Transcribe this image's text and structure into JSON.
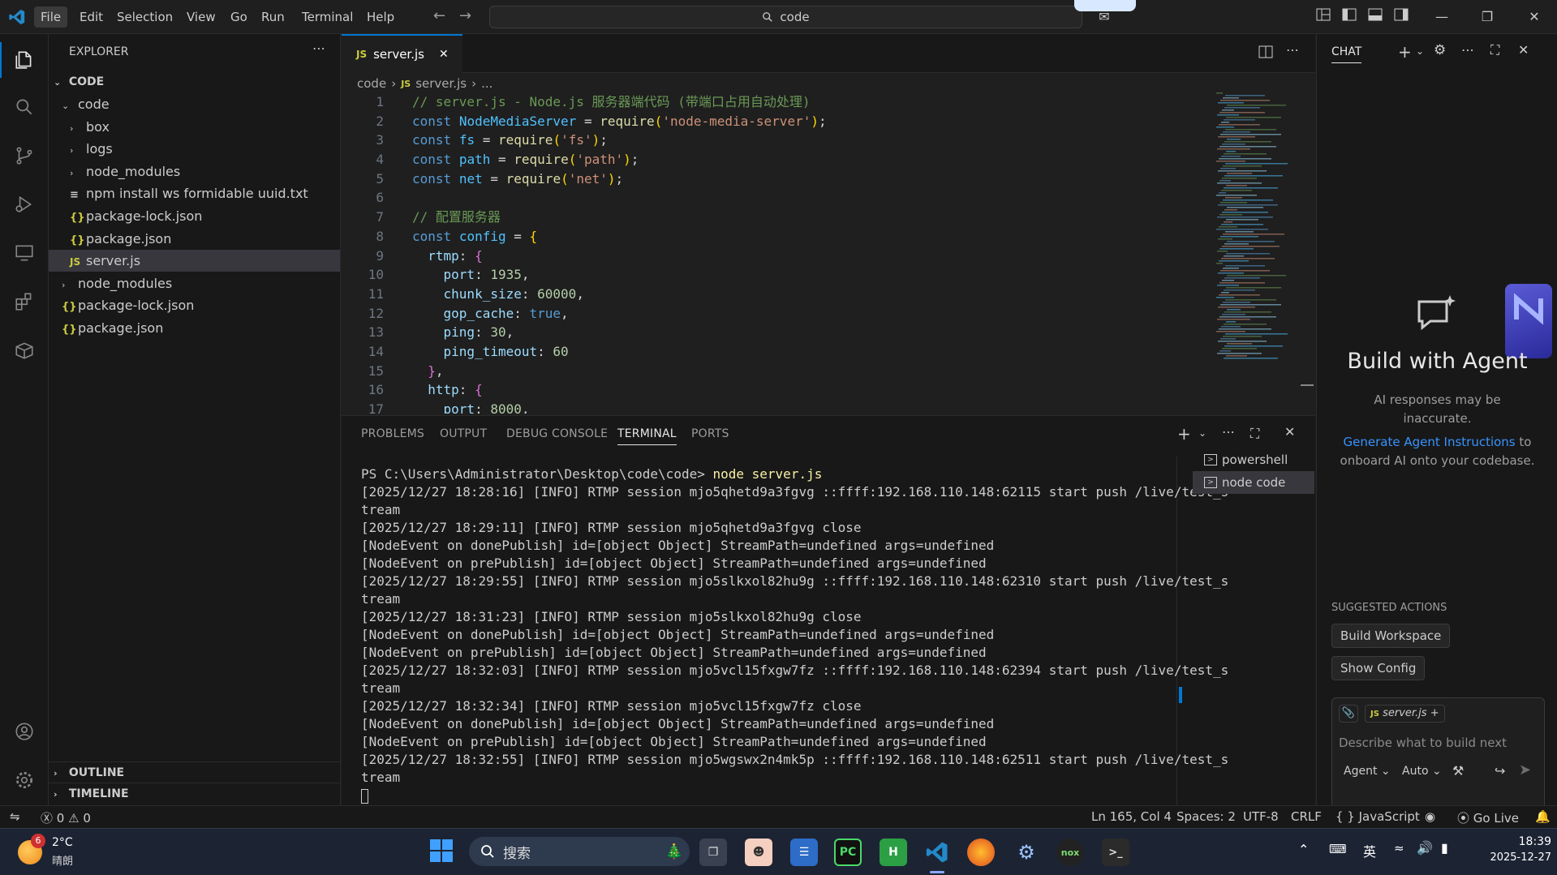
{
  "menu": [
    "File",
    "Edit",
    "Selection",
    "View",
    "Go",
    "Run",
    "Terminal",
    "Help"
  ],
  "search": {
    "text": "code"
  },
  "sidebar": {
    "title": "EXPLORER",
    "root": "CODE",
    "items": [
      {
        "label": "code",
        "kind": "folder-open",
        "depth": 1
      },
      {
        "label": "box",
        "kind": "folder",
        "depth": 2
      },
      {
        "label": "logs",
        "kind": "folder",
        "depth": 2
      },
      {
        "label": "node_modules",
        "kind": "folder",
        "depth": 2
      },
      {
        "label": "npm install ws formidable uuid.txt",
        "kind": "txt",
        "depth": 2
      },
      {
        "label": "package-lock.json",
        "kind": "json",
        "depth": 2
      },
      {
        "label": "package.json",
        "kind": "json",
        "depth": 2
      },
      {
        "label": "server.js",
        "kind": "js",
        "depth": 2,
        "selected": true
      },
      {
        "label": "node_modules",
        "kind": "folder",
        "depth": 1
      },
      {
        "label": "package-lock.json",
        "kind": "json",
        "depth": 1
      },
      {
        "label": "package.json",
        "kind": "json",
        "depth": 1
      }
    ],
    "outline": "OUTLINE",
    "timeline": "TIMELINE"
  },
  "editor": {
    "tab_label": "server.js",
    "breadcrumb": [
      "code",
      "server.js",
      "..."
    ],
    "lines": [
      "// server.js - Node.js 服务器端代码 (带端口占用自动处理)",
      "const NodeMediaServer = require('node-media-server');",
      "const fs = require('fs');",
      "const path = require('path');",
      "const net = require('net');",
      "",
      "// 配置服务器",
      "const config = {",
      "  rtmp: {",
      "    port: 1935,",
      "    chunk_size: 60000,",
      "    gop_cache: true,",
      "    ping: 30,",
      "    ping_timeout: 60",
      "  },",
      "  http: {",
      "    port: 8000,"
    ]
  },
  "panel": {
    "tabs": [
      "PROBLEMS",
      "OUTPUT",
      "DEBUG CONSOLE",
      "TERMINAL",
      "PORTS"
    ],
    "active_tab": "TERMINAL",
    "terminals": [
      "powershell",
      "node  code"
    ],
    "prompt": "PS C:\\Users\\Administrator\\Desktop\\code\\code> ",
    "command": "node server.js",
    "output": [
      "[2025/12/27 18:28:16] [INFO] RTMP session mjo5qhetd9a3fgvg ::ffff:192.168.110.148:62115 start push /live/test_s",
      "tream",
      "[2025/12/27 18:29:11] [INFO] RTMP session mjo5qhetd9a3fgvg close",
      "[NodeEvent on donePublish] id=[object Object] StreamPath=undefined args=undefined",
      "[NodeEvent on prePublish] id=[object Object] StreamPath=undefined args=undefined",
      "[2025/12/27 18:29:55] [INFO] RTMP session mjo5slkxol82hu9g ::ffff:192.168.110.148:62310 start push /live/test_s",
      "tream",
      "[2025/12/27 18:31:23] [INFO] RTMP session mjo5slkxol82hu9g close",
      "[NodeEvent on donePublish] id=[object Object] StreamPath=undefined args=undefined",
      "[NodeEvent on prePublish] id=[object Object] StreamPath=undefined args=undefined",
      "[2025/12/27 18:32:03] [INFO] RTMP session mjo5vcl15fxgw7fz ::ffff:192.168.110.148:62394 start push /live/test_s",
      "tream",
      "[2025/12/27 18:32:34] [INFO] RTMP session mjo5vcl15fxgw7fz close",
      "[NodeEvent on donePublish] id=[object Object] StreamPath=undefined args=undefined",
      "[NodeEvent on prePublish] id=[object Object] StreamPath=undefined args=undefined",
      "[2025/12/27 18:32:55] [INFO] RTMP session mjo5wgswx2n4mk5p ::ffff:192.168.110.148:62511 start push /live/test_s",
      "tream"
    ]
  },
  "chat": {
    "title": "CHAT",
    "heading": "Build with Agent",
    "disclaimer_1": "AI responses may be",
    "disclaimer_2": "inaccurate.",
    "link": "Generate Agent Instructions",
    "link_suffix": " to",
    "tail": "onboard AI onto your codebase.",
    "suggested_label": "SUGGESTED ACTIONS",
    "actions": [
      "Build Workspace",
      "Show Config"
    ],
    "context_file": "server.js",
    "placeholder": "Describe what to build next",
    "mode": "Agent",
    "model": "Auto"
  },
  "status": {
    "errors": "0",
    "warnings": "0",
    "position": "Ln 165, Col 4",
    "spaces": "Spaces: 2",
    "encoding": "UTF-8",
    "eol": "CRLF",
    "language": "JavaScript",
    "golive": "Go Live"
  },
  "taskbar": {
    "weather_temp": "2°C",
    "weather_desc": "晴朗",
    "weather_badge": "6",
    "search_placeholder": "搜索",
    "ime": "英",
    "time": "18:39",
    "date": "2025-12-27"
  },
  "colors": {
    "accent": "#0078d4",
    "link": "#3794ff"
  }
}
